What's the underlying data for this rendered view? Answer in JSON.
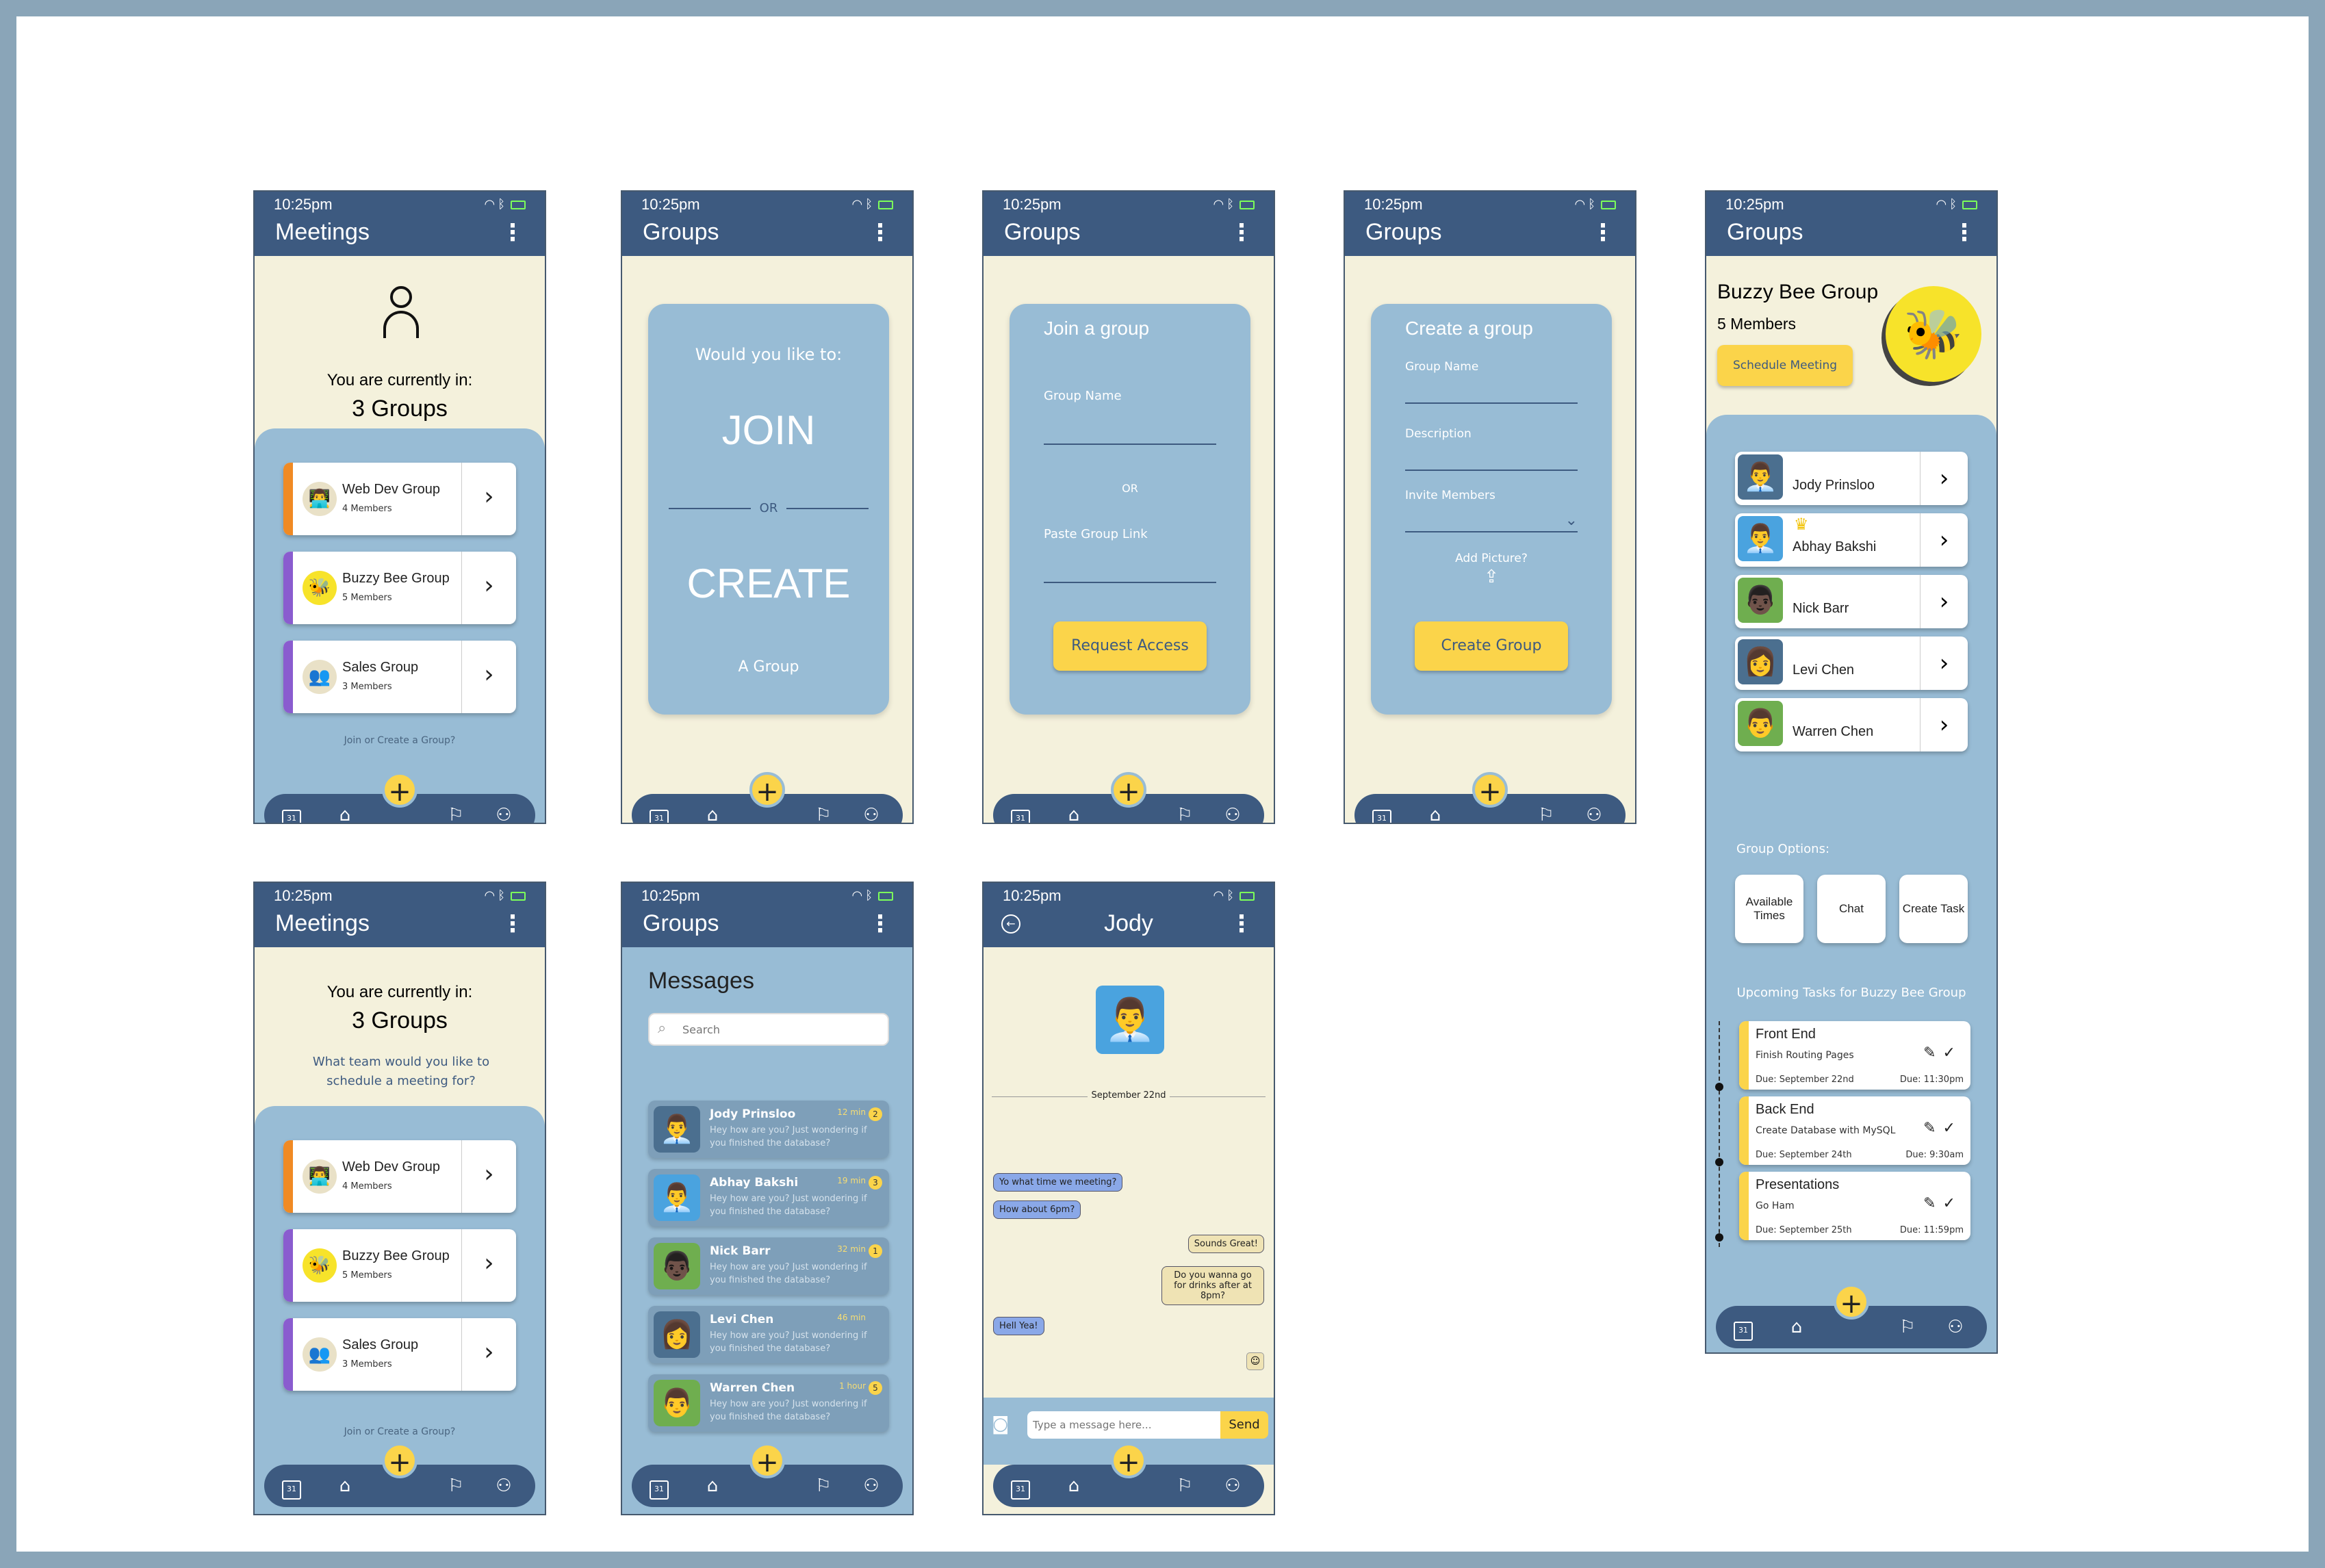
{
  "status": {
    "time": "10:25pm"
  },
  "nav": {
    "fab": "+",
    "calendar_day": "31"
  },
  "s1": {
    "title": "Meetings",
    "current_label": "You are currently in:",
    "count": "3 Groups",
    "groups": [
      {
        "name": "Web Dev Group",
        "members": "4 Members",
        "color": "#f08a24"
      },
      {
        "name": "Buzzy Bee Group",
        "members": "5 Members",
        "color": "#8a5ccf"
      },
      {
        "name": "Sales Group",
        "members": "3 Members",
        "color": "#8a5ccf"
      }
    ],
    "footer": "Join or Create a Group?"
  },
  "s2": {
    "title": "Groups",
    "prompt": "Would you like to:",
    "join": "JOIN",
    "or": "OR",
    "create": "CREATE",
    "suffix": "A Group"
  },
  "s3": {
    "title": "Groups",
    "heading": "Join a group",
    "group_name": "Group Name",
    "or": "OR",
    "paste_link": "Paste Group Link",
    "button": "Request Access"
  },
  "s4": {
    "title": "Groups",
    "heading": "Create a group",
    "group_name": "Group Name",
    "description": "Description",
    "invite": "Invite Members",
    "add_picture": "Add Picture?",
    "button": "Create Group"
  },
  "s5": {
    "title": "Groups",
    "group_name": "Buzzy Bee Group",
    "members_count": "5 Members",
    "schedule_button": "Schedule Meeting",
    "members": [
      {
        "name": "Jody Prinsloo",
        "bg": "#4b6f8f"
      },
      {
        "name": "Abhay Bakshi",
        "bg": "#4aa3df"
      },
      {
        "name": "Nick Barr",
        "bg": "#6fae4f"
      },
      {
        "name": "Levi Chen",
        "bg": "#4b6f8f"
      },
      {
        "name": "Warren Chen",
        "bg": "#6fae4f"
      }
    ],
    "options_label": "Group Options:",
    "options": [
      "Available Times",
      "Chat",
      "Create Task"
    ],
    "tasks_label": "Upcoming Tasks for Buzzy Bee Group",
    "tasks": [
      {
        "name": "Front End",
        "desc": "Finish Routing Pages",
        "due": "Due: September 22nd",
        "time": "Due: 11:30pm"
      },
      {
        "name": "Back End",
        "desc": "Create Database with MySQL",
        "due": "Due: September 24th",
        "time": "Due: 9:30am"
      },
      {
        "name": "Presentations",
        "desc": "Go Ham",
        "due": "Due: September 25th",
        "time": "Due: 11:59pm"
      }
    ]
  },
  "s6": {
    "title": "Meetings",
    "current_label": "You are currently in:",
    "count": "3 Groups",
    "question": "What team would you like to schedule a meeting for?",
    "groups": [
      {
        "name": "Web Dev Group",
        "members": "4 Members"
      },
      {
        "name": "Buzzy Bee Group",
        "members": "5 Members"
      },
      {
        "name": "Sales Group",
        "members": "3 Members"
      }
    ],
    "footer": "Join or Create a Group?"
  },
  "s7": {
    "title": "Groups",
    "heading": "Messages",
    "search_placeholder": "Search",
    "messages": [
      {
        "name": "Jody Prinsloo",
        "time": "12 min",
        "badge": "2",
        "preview": "Hey how are you? Just wondering if you finished the database?"
      },
      {
        "name": "Abhay Bakshi",
        "time": "19 min",
        "badge": "3",
        "preview": "Hey how are you? Just wondering if you finished the database?"
      },
      {
        "name": "Nick Barr",
        "time": "32 min",
        "badge": "1",
        "preview": "Hey how are you? Just wondering if you finished the database?"
      },
      {
        "name": "Levi Chen",
        "time": "46 min",
        "badge": "",
        "preview": "Hey how are you? Just wondering if you finished the database?"
      },
      {
        "name": "Warren Chen",
        "time": "1 hour",
        "badge": "5",
        "preview": "Hey how are you? Just wondering if you finished the database?"
      }
    ]
  },
  "s8": {
    "title": "Jody",
    "date": "September 22nd",
    "chat": [
      {
        "text": "Yo what time we meeting?",
        "from": "me"
      },
      {
        "text": "How about 6pm?",
        "from": "me"
      },
      {
        "text": "Sounds Great!",
        "from": "them"
      },
      {
        "text": "Do you wanna go for drinks after at 8pm?",
        "from": "them"
      },
      {
        "text": "Hell Yea!",
        "from": "me"
      }
    ],
    "input_placeholder": "Type a message here...",
    "send": "Send"
  }
}
